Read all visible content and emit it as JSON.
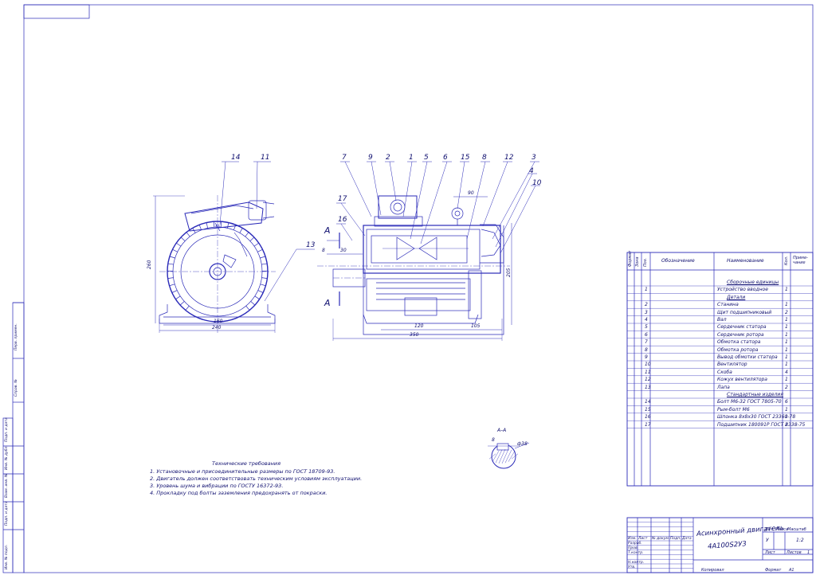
{
  "colors": {
    "line": "#2a2ab8",
    "ink": "#101070",
    "paper": "#ffffff"
  },
  "side_view": {
    "callouts": [
      "14",
      "11",
      "13"
    ],
    "dimensions": {
      "height": "260",
      "base_inner": "160",
      "base_outer": "240"
    }
  },
  "front_view": {
    "callouts": [
      "7",
      "9",
      "2",
      "1",
      "5",
      "6",
      "15",
      "8",
      "12",
      "3",
      "4",
      "10",
      "17",
      "16"
    ],
    "section_mark": "А",
    "dimensions": {
      "d90": "90",
      "d8": "8",
      "d30": "30",
      "d205": "205",
      "d120": "120",
      "d105": "105",
      "d350": "350"
    }
  },
  "section_view": {
    "title": "А–А",
    "d8": "8",
    "d38": "ф38"
  },
  "requirements": {
    "title": "Технические требования",
    "items": [
      "1. Установочные и присоединительные размеры по ГОСТ 18709-93.",
      "2. Двигатель должен соответствовать техническим условиям эксплуатации.",
      "3. Уровень шума и вибрации по ГОСТУ 16372-93.",
      "4. Прокладку под болты заземления предохранять от покраски."
    ]
  },
  "spec_table": {
    "headers": {
      "format": "Формат",
      "zone": "Зона",
      "pos": "Поз.",
      "designation": "Обозначение",
      "name": "Наименование",
      "qty": "Кол.",
      "note": "Приме-чание"
    },
    "rows": [
      {
        "pos": "",
        "name": "Сборочные единицы",
        "qty": "",
        "section": true
      },
      {
        "pos": "1",
        "name": "Устройство вводное",
        "qty": "1"
      },
      {
        "pos": "",
        "name": "Детали",
        "qty": "",
        "section": true
      },
      {
        "pos": "2",
        "name": "Станина",
        "qty": "1"
      },
      {
        "pos": "3",
        "name": "Щит подшипниковый",
        "qty": "2"
      },
      {
        "pos": "4",
        "name": "Вал",
        "qty": "1"
      },
      {
        "pos": "5",
        "name": "Сердечник статора",
        "qty": "1"
      },
      {
        "pos": "6",
        "name": "Сердечник ротора",
        "qty": "1"
      },
      {
        "pos": "7",
        "name": "Обмотка статора",
        "qty": "1"
      },
      {
        "pos": "8",
        "name": "Обмотка ротора",
        "qty": "1"
      },
      {
        "pos": "9",
        "name": "Вывод обмотки статора",
        "qty": "1"
      },
      {
        "pos": "10",
        "name": "Вентилятор",
        "qty": "1"
      },
      {
        "pos": "11",
        "name": "Скоба",
        "qty": "4"
      },
      {
        "pos": "12",
        "name": "Кожух вентилятора",
        "qty": "1"
      },
      {
        "pos": "13",
        "name": "Лапа",
        "qty": "2"
      },
      {
        "pos": "",
        "name": "Стандартные изделия",
        "qty": "",
        "section": true
      },
      {
        "pos": "14",
        "name": "Болт М6-32 ГОСТ 7805-70",
        "qty": "6"
      },
      {
        "pos": "15",
        "name": "Рым-болт М6",
        "qty": "1"
      },
      {
        "pos": "16",
        "name": "Шпонка 8х8х30 ГОСТ 23360-78",
        "qty": "1"
      },
      {
        "pos": "17",
        "name": "Подшипник 180091Р ГОСТ 8338-75",
        "qty": "2"
      }
    ]
  },
  "title_block": {
    "title": "Асинхронный двигатель",
    "code": "4А100S2У3",
    "letter_label": "Лит.",
    "mass_label": "Масса",
    "scale_label": "Масштаб",
    "letter": "У",
    "scale": "1:2",
    "sheet_label": "Лист",
    "sheets_label": "Листов",
    "sheets": "1",
    "rows": [
      "Изм.",
      "Лист",
      "№ докум.",
      "Подп.",
      "Дата",
      "Разраб.",
      "Пров.",
      "Т.контр.",
      "Н.контр.",
      "Утв."
    ]
  },
  "footer": {
    "copied": "Копировал",
    "format": "Формат",
    "format_value": "А1"
  },
  "side_stamps": [
    "Перв. примен.",
    "Справ. №",
    "Подп. и дата",
    "Инв. № дубл.",
    "Взам. инв. №",
    "Подп. и дата",
    "Инв. № подл."
  ]
}
